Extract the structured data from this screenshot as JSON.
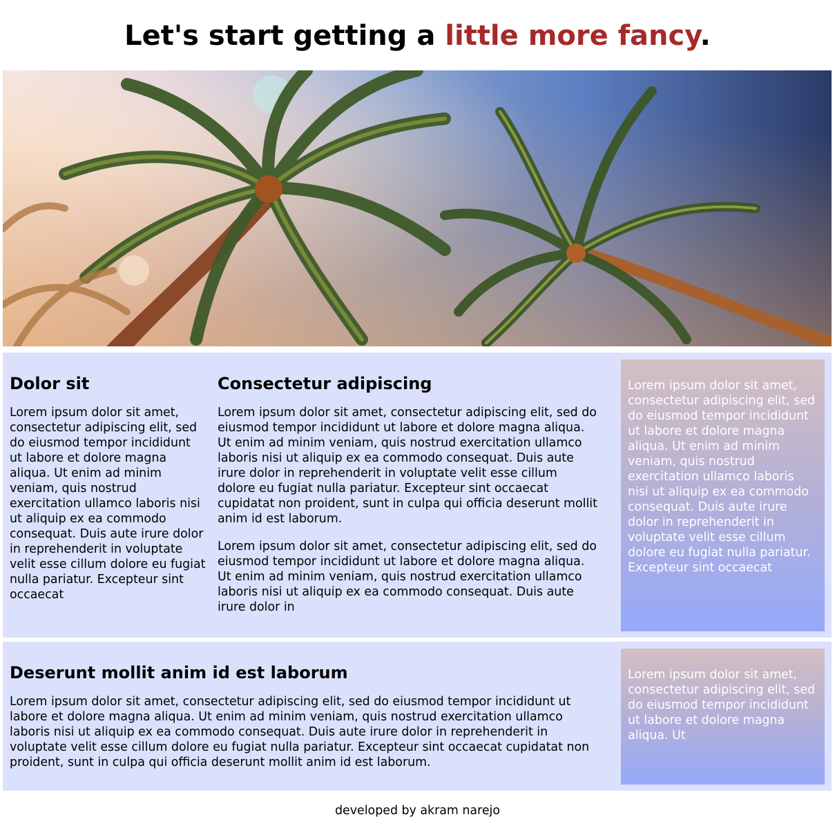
{
  "header": {
    "title_before": "Let's start getting a ",
    "title_accent": "little more fancy",
    "title_after": ".",
    "accent_color": "#a52a2a"
  },
  "hero": {
    "alt": "palm trees"
  },
  "section1": {
    "col1": {
      "heading": "Dolor sit",
      "text": "Lorem ipsum dolor sit amet, consectetur adipiscing elit, sed do eiusmod tempor incididunt ut labore et dolore magna aliqua. Ut enim ad minim veniam, quis nostrud exercitation ullamco laboris nisi ut aliquip ex ea commodo consequat. Duis aute irure dolor in reprehenderit in voluptate velit esse cillum dolore eu fugiat nulla pariatur. Excepteur sint occaecat"
    },
    "col2": {
      "heading": "Consectetur adipiscing",
      "para1": "Lorem ipsum dolor sit amet, consectetur adipiscing elit, sed do eiusmod tempor incididunt ut labore et dolore magna aliqua. Ut enim ad minim veniam, quis nostrud exercitation ullamco laboris nisi ut aliquip ex ea commodo consequat. Duis aute irure dolor in reprehenderit in voluptate velit esse cillum dolore eu fugiat nulla pariatur. Excepteur sint occaecat cupidatat non proident, sunt in culpa qui officia deserunt mollit anim id est laborum.",
      "para2": "Lorem ipsum dolor sit amet, consectetur adipiscing elit, sed do eiusmod tempor incididunt ut labore et dolore magna aliqua. Ut enim ad minim veniam, quis nostrud exercitation ullamco laboris nisi ut aliquip ex ea commodo consequat. Duis aute irure dolor in"
    },
    "aside": {
      "text": "Lorem ipsum dolor sit amet, consectetur adipiscing elit, sed do eiusmod tempor incididunt ut labore et dolore magna aliqua. Ut enim ad minim veniam, quis nostrud exercitation ullamco laboris nisi ut aliquip ex ea commodo consequat. Duis aute irure dolor in reprehenderit in voluptate velit esse cillum dolore eu fugiat nulla pariatur. Excepteur sint occaecat"
    }
  },
  "section2": {
    "heading": "Deserunt mollit anim id est laborum",
    "text": "Lorem ipsum dolor sit amet, consectetur adipiscing elit, sed do eiusmod tempor incididunt ut labore et dolore magna aliqua. Ut enim ad minim veniam, quis nostrud exercitation ullamco laboris nisi ut aliquip ex ea commodo consequat. Duis aute irure dolor in reprehenderit in voluptate velit esse cillum dolore eu fugiat nulla pariatur. Excepteur sint occaecat cupidatat non proident, sunt in culpa qui officia deserunt mollit anim id est laborum.",
    "aside": {
      "text": "Lorem ipsum dolor sit amet, consectetur adipiscing elit, sed do eiusmod tempor incididunt ut labore et dolore magna aliqua. Ut"
    }
  },
  "footer": {
    "text": "developed by akram narejo"
  }
}
